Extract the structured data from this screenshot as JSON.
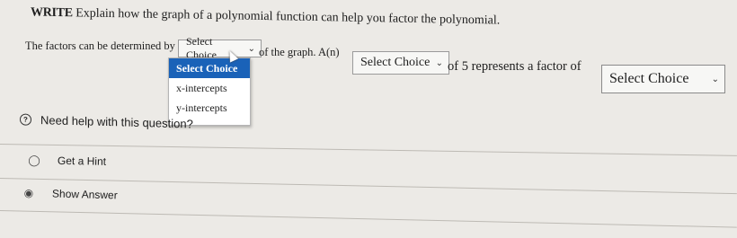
{
  "question": {
    "prefix": "WRITE",
    "text": "Explain how the graph of a polynomial function can help you factor the polynomial."
  },
  "sentence": {
    "part1": "The factors can be determined by the",
    "part2": "of the graph. A(n)",
    "part3": "of 5 represents a factor of"
  },
  "selects": [
    {
      "value": "Select Choice"
    },
    {
      "value": "Select Choice"
    },
    {
      "value": "Select Choice"
    }
  ],
  "dropdown": {
    "options": [
      "Select Choice",
      "x-intercepts",
      "y-intercepts"
    ],
    "selected_index": 0
  },
  "help": {
    "title": "Need help with this question?",
    "items": [
      {
        "label": "Get a Hint",
        "icon": "lightbulb-icon"
      },
      {
        "label": "Show Answer",
        "icon": "eye-icon"
      }
    ]
  },
  "colors": {
    "highlight": "#1a62b8",
    "background": "#eceae6"
  }
}
